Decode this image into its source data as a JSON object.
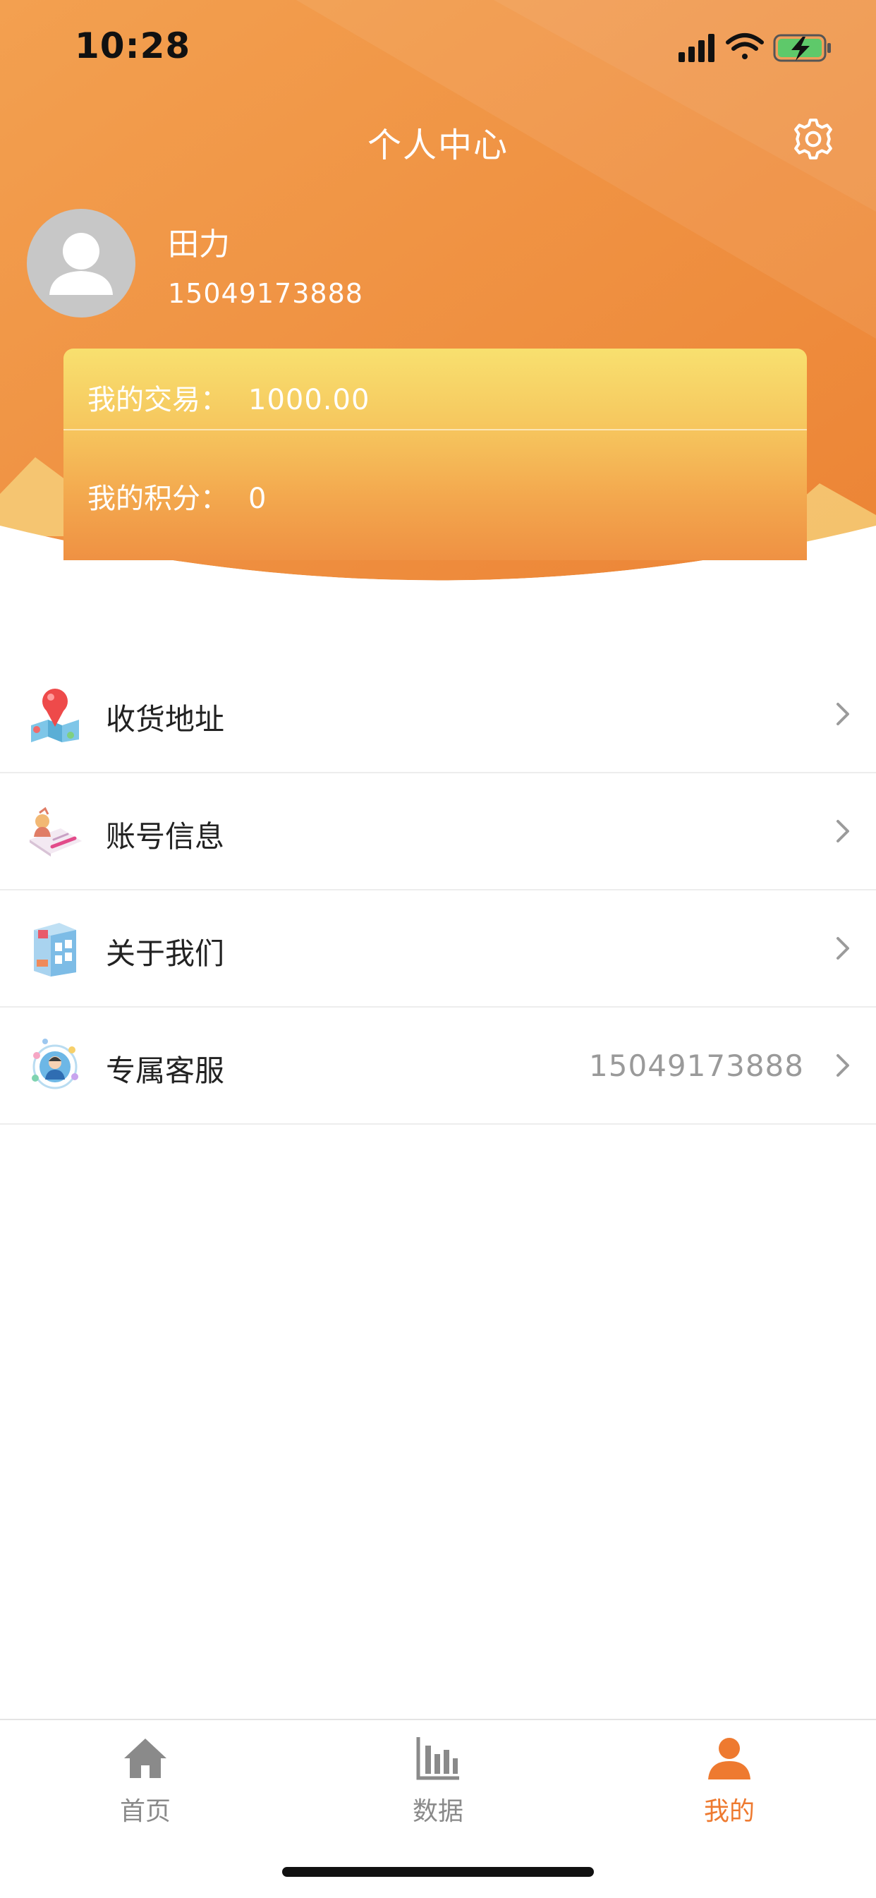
{
  "status_bar": {
    "time": "10:28"
  },
  "header": {
    "title": "个人中心",
    "user": {
      "name": "田力",
      "phone": "15049173888"
    },
    "stats": [
      {
        "label": "我的交易：",
        "value": "1000.00"
      },
      {
        "label": "我的积分：",
        "value": "0"
      }
    ]
  },
  "menu": {
    "items": [
      {
        "label": "收货地址",
        "value": "",
        "icon": "map-pin-icon"
      },
      {
        "label": "账号信息",
        "value": "",
        "icon": "id-card-icon"
      },
      {
        "label": "关于我们",
        "value": "",
        "icon": "building-icon"
      },
      {
        "label": "专属客服",
        "value": "15049173888",
        "icon": "customer-service-icon"
      }
    ]
  },
  "tabbar": {
    "tabs": [
      {
        "label": "首页",
        "icon": "home-icon"
      },
      {
        "label": "数据",
        "icon": "bar-chart-icon"
      },
      {
        "label": "我的",
        "icon": "user-icon"
      }
    ],
    "active_tab": "我的"
  },
  "colors": {
    "accent": "#ee7a30",
    "header_gradient_start": "#f3a050",
    "header_gradient_end": "#ec8435",
    "card_top": "#f8e06f",
    "inactive_tab": "#8a8a8a"
  }
}
